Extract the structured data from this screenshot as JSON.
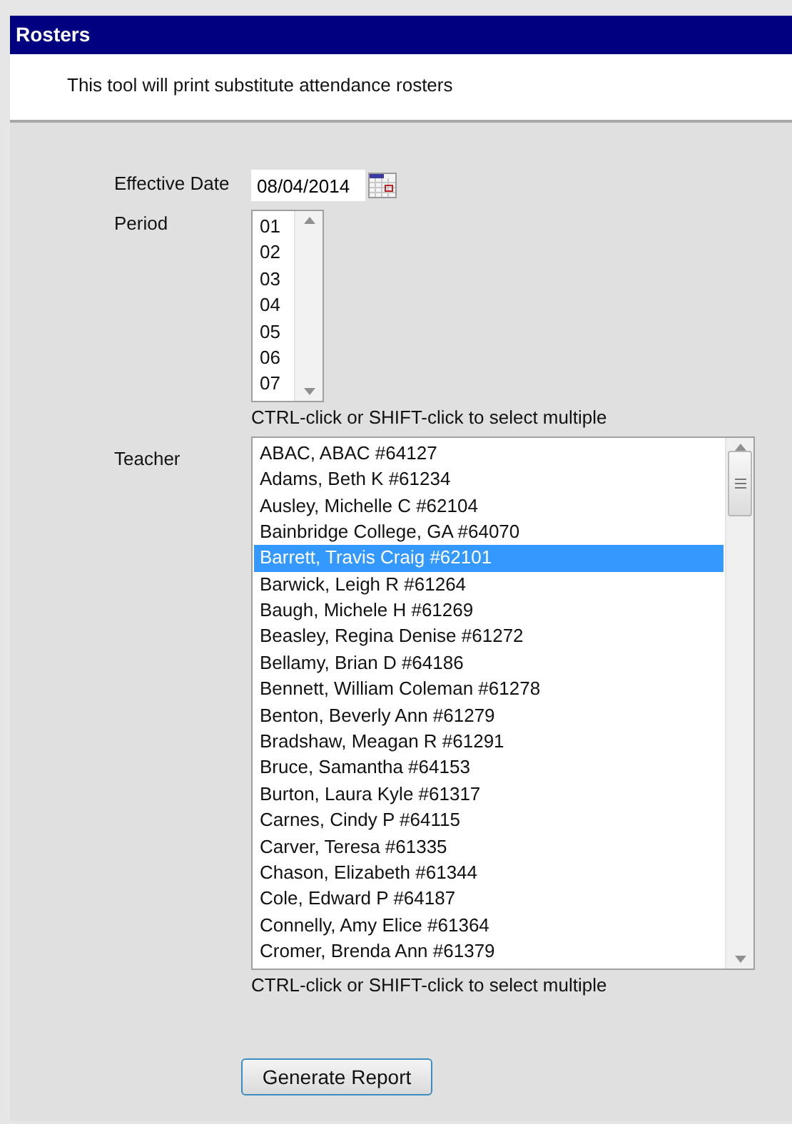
{
  "header": {
    "title": "Rosters"
  },
  "description": "This tool will print substitute attendance rosters",
  "effective_date": {
    "label": "Effective Date",
    "value": "08/04/2014"
  },
  "period": {
    "label": "Period",
    "options": [
      {
        "label": "01",
        "selected": false
      },
      {
        "label": "02",
        "selected": false
      },
      {
        "label": "03",
        "selected": false
      },
      {
        "label": "04",
        "selected": false
      },
      {
        "label": "05",
        "selected": false
      },
      {
        "label": "06",
        "selected": false
      },
      {
        "label": "07",
        "selected": false
      }
    ],
    "hint": "CTRL-click or SHIFT-click to select multiple"
  },
  "teacher": {
    "label": "Teacher",
    "options": [
      {
        "label": "ABAC, ABAC #64127",
        "selected": false
      },
      {
        "label": "Adams, Beth K #61234",
        "selected": false
      },
      {
        "label": "Ausley, Michelle C #62104",
        "selected": false
      },
      {
        "label": "Bainbridge College, GA #64070",
        "selected": false
      },
      {
        "label": "Barrett, Travis Craig #62101",
        "selected": true
      },
      {
        "label": "Barwick, Leigh R #61264",
        "selected": false
      },
      {
        "label": "Baugh, Michele H #61269",
        "selected": false
      },
      {
        "label": "Beasley, Regina Denise #61272",
        "selected": false
      },
      {
        "label": "Bellamy, Brian D #64186",
        "selected": false
      },
      {
        "label": "Bennett, William Coleman #61278",
        "selected": false
      },
      {
        "label": "Benton, Beverly Ann #61279",
        "selected": false
      },
      {
        "label": "Bradshaw, Meagan R #61291",
        "selected": false
      },
      {
        "label": "Bruce, Samantha #64153",
        "selected": false
      },
      {
        "label": "Burton, Laura Kyle #61317",
        "selected": false
      },
      {
        "label": "Carnes, Cindy P #64115",
        "selected": false
      },
      {
        "label": "Carver, Teresa #61335",
        "selected": false
      },
      {
        "label": "Chason, Elizabeth #61344",
        "selected": false
      },
      {
        "label": "Cole, Edward P #64187",
        "selected": false
      },
      {
        "label": "Connelly, Amy Elice #61364",
        "selected": false
      },
      {
        "label": "Cromer, Brenda Ann #61379",
        "selected": false
      }
    ],
    "hint": "CTRL-click or SHIFT-click to select multiple"
  },
  "button": "Generate Report"
}
